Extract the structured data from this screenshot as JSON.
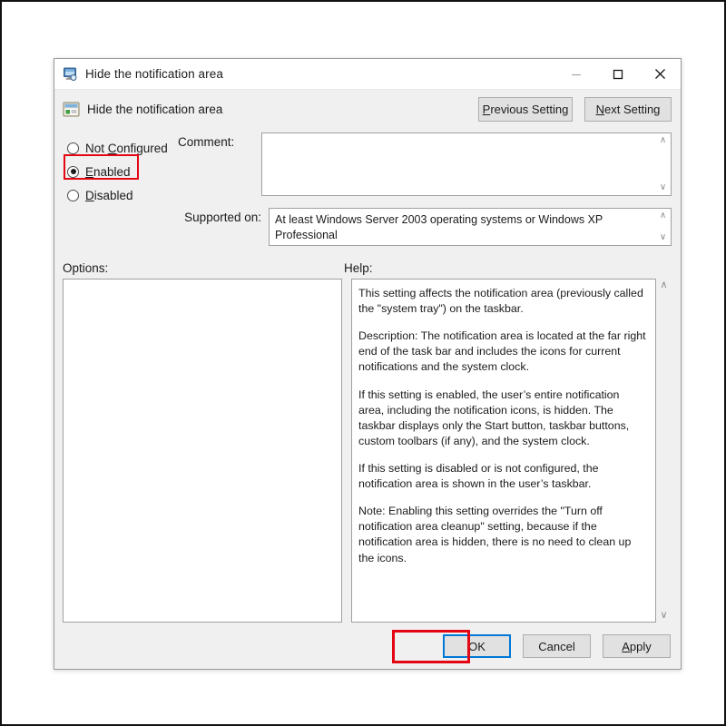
{
  "window": {
    "title": "Hide the notification area",
    "title_icon": "computer-monitor-icon",
    "minimize_label": "–",
    "maximize_label": "□",
    "close_label": "✕"
  },
  "header": {
    "icon": "taskbar-settings-icon",
    "policy_name": "Hide the notification area",
    "previous_button": {
      "accel": "P",
      "rest": "revious Setting"
    },
    "next_button": {
      "accel": "N",
      "rest": "ext Setting"
    }
  },
  "state_options": {
    "not_configured": {
      "accel_before": "Not ",
      "accel": "C",
      "rest": "onfigured",
      "selected": false
    },
    "enabled": {
      "accel_before": "",
      "accel": "E",
      "rest": "nabled",
      "selected": true
    },
    "disabled": {
      "accel_before": "",
      "accel": "D",
      "rest": "isabled",
      "selected": false
    },
    "highlight_color": "#e30613"
  },
  "fields": {
    "comment_label": "Comment:",
    "comment_value": "",
    "supported_label": "Supported on:",
    "supported_value": "At least Windows Server 2003 operating systems or Windows XP Professional",
    "scroll_up_glyph": "∧",
    "scroll_down_glyph": "∨"
  },
  "panels": {
    "options_label": "Options:",
    "options_content": "",
    "help_label": "Help:",
    "help_paragraphs": [
      "This setting affects the notification area (previously called the \"system tray\") on the taskbar.",
      "Description: The notification area is located at the far right end of the task bar and includes the icons for current notifications and the system clock.",
      "If this setting is enabled, the user’s entire notification area, including the notification icons, is hidden. The taskbar displays only the Start button, taskbar buttons, custom toolbars (if any), and the system clock.",
      "If this setting is disabled or is not configured, the notification area is shown in the user’s taskbar.",
      "Note: Enabling this setting overrides the \"Turn off notification area cleanup\" setting, because if the notification area is hidden, there is no need to clean up the icons."
    ]
  },
  "footer": {
    "ok_label": "OK",
    "cancel_label": "Cancel",
    "apply": {
      "accel": "A",
      "rest": "pply"
    },
    "ok_focus_color": "#0078d7",
    "ok_highlight_color": "#e30613"
  }
}
